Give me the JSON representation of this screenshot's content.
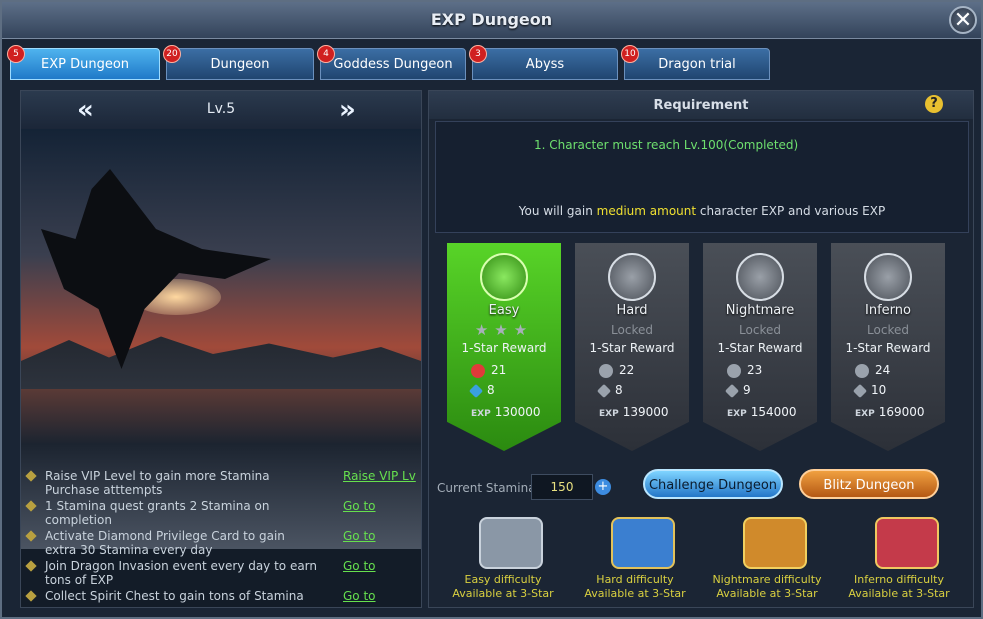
{
  "window": {
    "title": "EXP Dungeon",
    "close_icon": "close-icon"
  },
  "tabs": [
    {
      "label": "EXP Dungeon",
      "badge": "5",
      "active": true
    },
    {
      "label": "Dungeon",
      "badge": "20",
      "active": false
    },
    {
      "label": "Goddess Dungeon",
      "badge": "4",
      "active": false
    },
    {
      "label": "Abyss",
      "badge": "3",
      "active": false
    },
    {
      "label": "Dragon trial",
      "badge": "10",
      "active": false
    }
  ],
  "level": {
    "label": "Lv.5"
  },
  "tips": [
    {
      "text": "Raise VIP Level to gain more Stamina Purchase atttempts",
      "link": "Raise VIP Lv"
    },
    {
      "text": "1 Stamina quest grants 2 Stamina on completion",
      "link": "Go to"
    },
    {
      "text": "Activate Diamond Privilege Card to gain extra 30 Stamina every day",
      "link": "Go to"
    },
    {
      "text": "Join Dragon Invasion event every day to earn tons of EXP",
      "link": "Go to"
    },
    {
      "text": "Collect Spirit Chest to gain tons of Stamina",
      "link": "Go to"
    }
  ],
  "requirement": {
    "title": "Requirement",
    "help": "?",
    "line1": "1. Character must reach Lv.100(Completed)",
    "gain_prefix": "You will gain ",
    "gain_highlight": "medium amount",
    "gain_suffix": " character EXP and various EXP"
  },
  "difficulties": [
    {
      "name": "Easy",
      "locked": "",
      "stars": "★★★",
      "reward_label": "1-Star Reward",
      "r1": "21",
      "r2": "8",
      "exp_label": "EXP",
      "exp": "130000"
    },
    {
      "name": "Hard",
      "locked": "Locked",
      "stars": "",
      "reward_label": "1-Star Reward",
      "r1": "22",
      "r2": "8",
      "exp_label": "EXP",
      "exp": "139000"
    },
    {
      "name": "Nightmare",
      "locked": "Locked",
      "stars": "",
      "reward_label": "1-Star Reward",
      "r1": "23",
      "r2": "9",
      "exp_label": "EXP",
      "exp": "154000"
    },
    {
      "name": "Inferno",
      "locked": "Locked",
      "stars": "",
      "reward_label": "1-Star Reward",
      "r1": "24",
      "r2": "10",
      "exp_label": "EXP",
      "exp": "169000"
    }
  ],
  "stamina": {
    "label": "Current Stamina",
    "value": "150",
    "plus": "+"
  },
  "buttons": {
    "challenge": "Challenge Dungeon",
    "blitz": "Blitz Dungeon"
  },
  "chests": [
    {
      "line1": "Easy difficulty",
      "line2": "Available at 3-Star",
      "color": "#8a97a6"
    },
    {
      "line1": "Hard difficulty",
      "line2": "Available at 3-Star",
      "color": "#3b7fd0"
    },
    {
      "line1": "Nightmare difficulty",
      "line2": "Available at 3-Star",
      "color": "#d08a2b"
    },
    {
      "line1": "Inferno difficulty",
      "line2": "Available at 3-Star",
      "color": "#c43a4a"
    }
  ]
}
